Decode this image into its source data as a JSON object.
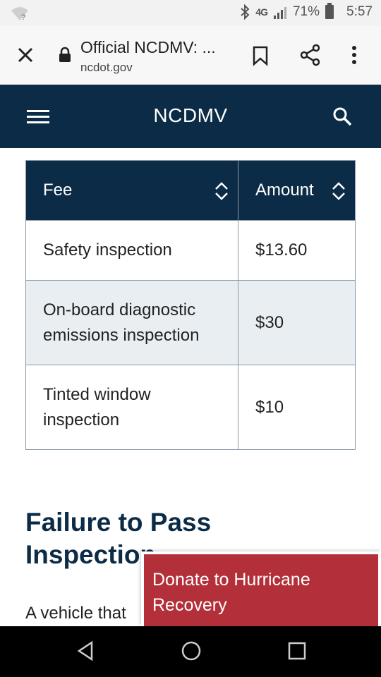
{
  "status_bar": {
    "network": "4G",
    "battery": "71%",
    "time": "5:57"
  },
  "browser": {
    "title": "Official NCDMV: ...",
    "domain": "ncdot.gov"
  },
  "site": {
    "title": "NCDMV"
  },
  "table": {
    "headers": [
      "Fee",
      "Amount"
    ],
    "rows": [
      {
        "fee": "Safety inspection",
        "amount": "$13.60"
      },
      {
        "fee": "On-board diagnostic emissions inspection",
        "amount": "$30"
      },
      {
        "fee": "Tinted window inspection",
        "amount": "$10"
      }
    ]
  },
  "section": {
    "heading": "Failure to Pass Inspection",
    "text": "A vehicle that"
  },
  "banner": {
    "label": "Donate to Hurricane Recovery",
    "color": "#b3303a"
  },
  "colors": {
    "header_bg": "#0c2b46",
    "row_alt": "#e9eef2"
  }
}
